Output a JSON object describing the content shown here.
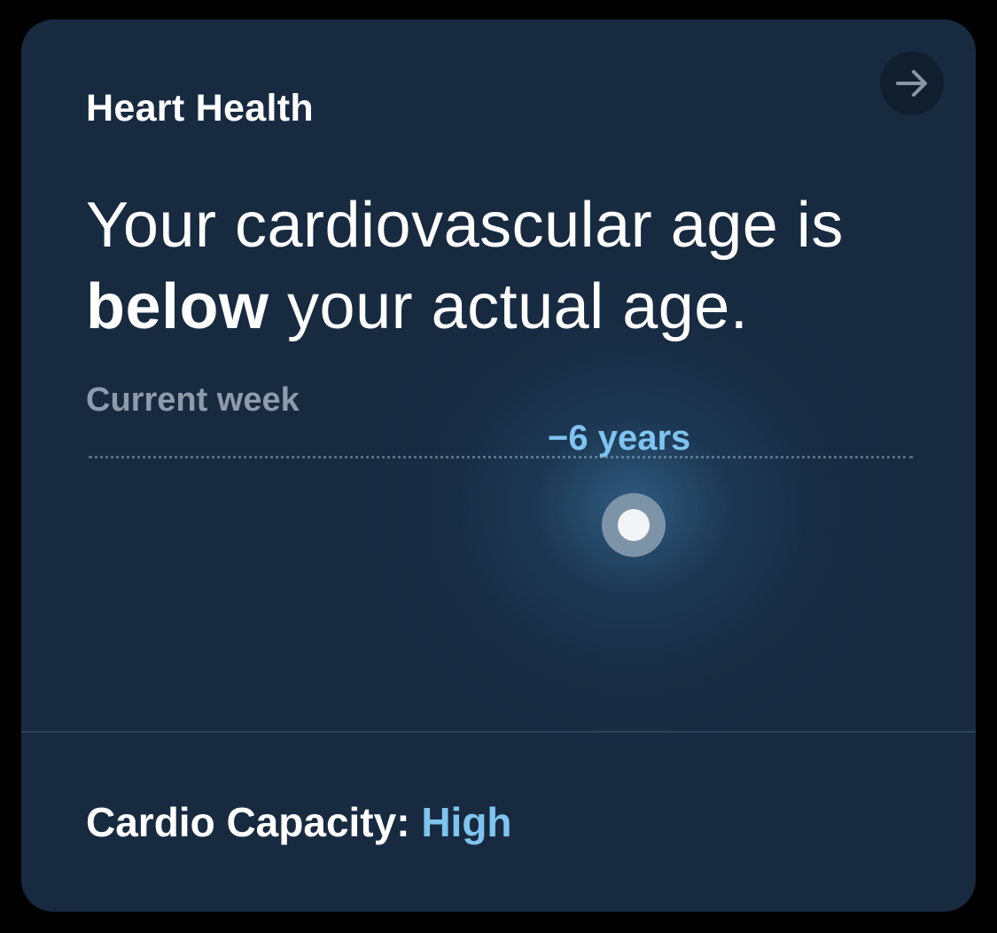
{
  "card": {
    "title": "Heart Health",
    "headline": {
      "line1": "Your cardiovascular age is",
      "emphasis": "below",
      "rest": " your actual age."
    },
    "period_label": "Current week",
    "delta_label": "−6 years",
    "footer": {
      "label": "Cardio Capacity:",
      "value": "High"
    },
    "open_button_icon": "arrow-right-icon"
  },
  "colors": {
    "card_background": "#172a40",
    "accent": "#7fc4ef",
    "muted_text": "#8f9aaa"
  }
}
